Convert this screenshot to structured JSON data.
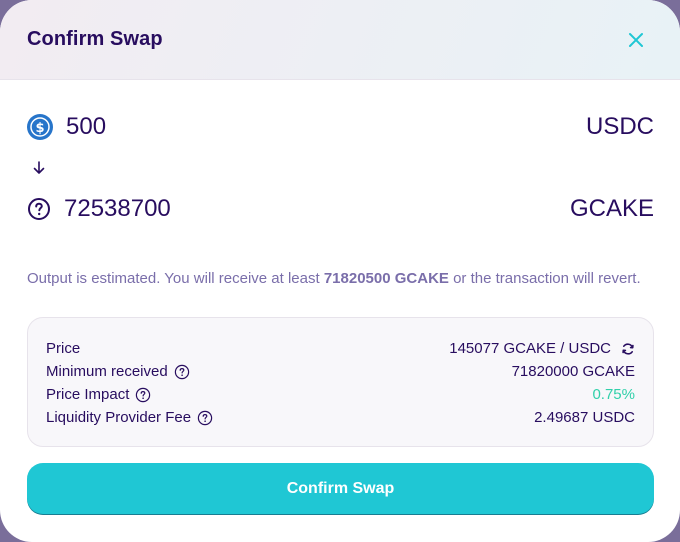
{
  "modal": {
    "title": "Confirm Swap",
    "close_icon": "close-icon"
  },
  "input_token": {
    "icon": "usdc-icon",
    "amount": "500",
    "symbol": "USDC"
  },
  "arrow_icon": "arrow-down-icon",
  "output_token": {
    "icon": "question-circle-icon",
    "amount": "72538700",
    "symbol": "GCAKE"
  },
  "estimate": {
    "prefix": "Output is estimated. You will receive at least ",
    "min_amount": "71820500 GCAKE",
    "suffix": " or the transaction will revert."
  },
  "details": {
    "price_label": "Price",
    "price_value": "145077 GCAKE / USDC",
    "minimum_label": "Minimum received",
    "minimum_value": "71820000 GCAKE",
    "impact_label": "Price Impact",
    "impact_value": "0.75%",
    "fee_label": "Liquidity Provider Fee",
    "fee_value": "2.49687 USDC"
  },
  "confirm_button": "Confirm Swap",
  "colors": {
    "text": "#280d5f",
    "secondary": "#7a6eaa",
    "primary": "#1fc7d4",
    "success": "#31d0aa",
    "usdc": "#2775ca"
  }
}
